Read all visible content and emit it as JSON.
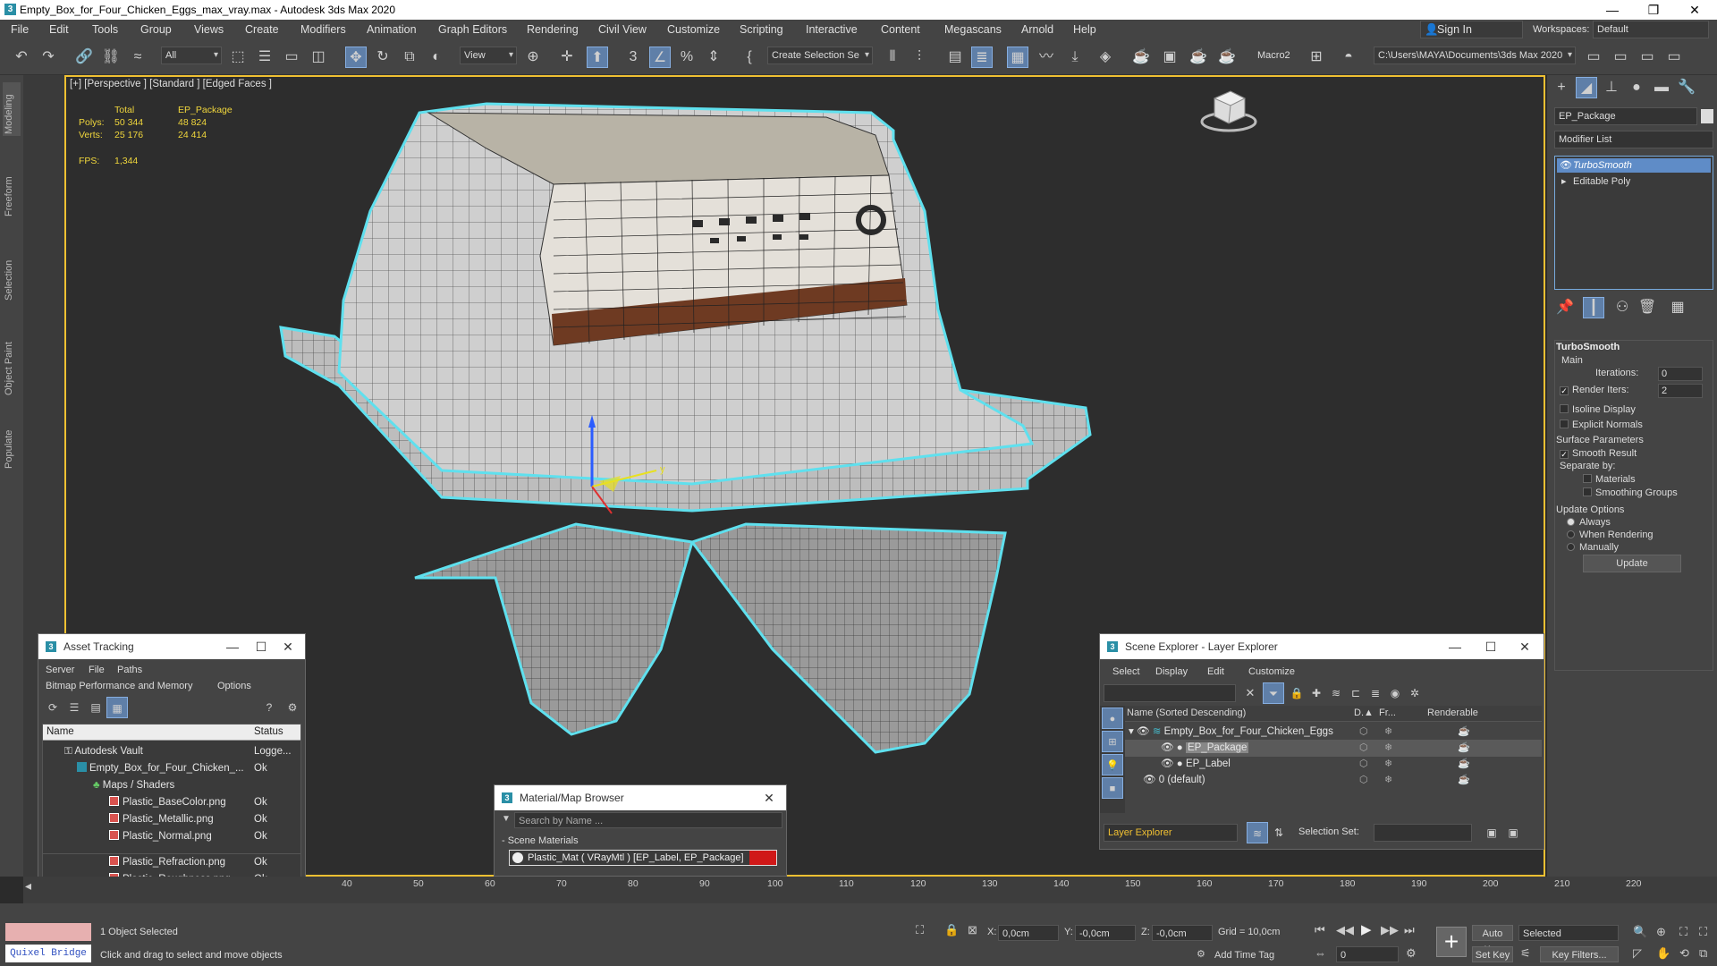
{
  "window": {
    "title": "Empty_Box_for_Four_Chicken_Eggs_max_vray.max - Autodesk 3ds Max 2020",
    "minimize": "—",
    "restore": "❐",
    "close": "✕"
  },
  "menubar": {
    "items": [
      "File",
      "Edit",
      "Tools",
      "Group",
      "Views",
      "Create",
      "Modifiers",
      "Animation",
      "Graph Editors",
      "Rendering",
      "Civil View",
      "Customize",
      "Scripting",
      "Interactive",
      "Content",
      "Megascans",
      "Arnold",
      "Help"
    ],
    "signin": "Sign In",
    "workspaces_label": "Workspaces:",
    "workspace_value": "Default"
  },
  "toolbar": {
    "selection_filter": "All",
    "ref_coord": "View",
    "named_selection": "Create Selection Se",
    "macro": "Macro2",
    "project_path": "C:\\Users\\MAYA\\Documents\\3ds Max 2020"
  },
  "command_tabs": [
    "Modeling",
    "Freeform",
    "Selection",
    "Object Paint",
    "Populate"
  ],
  "viewport": {
    "label": "[+] [Perspective ] [Standard ] [Edged Faces ]",
    "stats": {
      "col_total": "Total",
      "col_object": "EP_Package",
      "polys_label": "Polys:",
      "polys_total": "50 344",
      "polys_obj": "48 824",
      "verts_label": "Verts:",
      "verts_total": "25 176",
      "verts_obj": "24 414",
      "fps_label": "FPS:",
      "fps_value": "1,344"
    },
    "gizmo_axis_y": "y"
  },
  "command_panel": {
    "object_name": "EP_Package",
    "modifier_list": "Modifier List",
    "stack": [
      "TurboSmooth",
      "Editable Poly"
    ],
    "rollout_title": "TurboSmooth",
    "main_label": "Main",
    "iterations_label": "Iterations:",
    "iterations_value": "0",
    "render_iters_label": "Render Iters:",
    "render_iters_value": "2",
    "isoline": "Isoline Display",
    "explicit_normals": "Explicit Normals",
    "surface_params": "Surface Parameters",
    "smooth_result": "Smooth Result",
    "separate_by": "Separate by:",
    "materials": "Materials",
    "smoothing_groups": "Smoothing Groups",
    "update_options": "Update Options",
    "always": "Always",
    "when_rendering": "When Rendering",
    "manually": "Manually",
    "update_button": "Update"
  },
  "asset_tracking": {
    "title": "Asset Tracking",
    "menu1": [
      "Server",
      "File",
      "Paths"
    ],
    "menu2": [
      "Bitmap Performance and Memory",
      "Options"
    ],
    "col_name": "Name",
    "col_status": "Status",
    "rows": [
      {
        "name": "Autodesk Vault",
        "status": "Logge..."
      },
      {
        "name": "Empty_Box_for_Four_Chicken_...",
        "status": "Ok"
      },
      {
        "name": "Maps / Shaders",
        "status": ""
      },
      {
        "name": "Plastic_BaseColor.png",
        "status": "Ok"
      },
      {
        "name": "Plastic_Metallic.png",
        "status": "Ok"
      },
      {
        "name": "Plastic_Normal.png",
        "status": "Ok"
      },
      {
        "name": "Plastic_Refraction.png",
        "status": "Ok"
      },
      {
        "name": "Plastic_Roughness.png",
        "status": "Ok"
      }
    ]
  },
  "material_browser": {
    "title": "Material/Map Browser",
    "search_placeholder": "Search by Name ...",
    "section": "- Scene Materials",
    "material": "Plastic_Mat  ( VRayMtl )  [EP_Label, EP_Package]"
  },
  "scene_explorer": {
    "title": "Scene Explorer - Layer Explorer",
    "menu": [
      "Select",
      "Display",
      "Edit",
      "Customize"
    ],
    "col_name": "Name (Sorted Descending)",
    "col_d": "D.▲",
    "col_fr": "Fr...",
    "col_renderable": "Renderable",
    "rows": [
      "Empty_Box_for_Four_Chicken_Eggs",
      "EP_Package",
      "EP_Label",
      "0 (default)"
    ],
    "explorer_select": "Layer Explorer",
    "selection_set_label": "Selection Set:"
  },
  "timeline": {
    "ticks": [
      "40",
      "50",
      "60",
      "70",
      "80",
      "90",
      "100",
      "110",
      "120",
      "130",
      "140",
      "150",
      "160",
      "170",
      "180",
      "190",
      "200",
      "210",
      "220"
    ]
  },
  "statusbar": {
    "quixel": "Quixel Bridge",
    "selected": "1 Object Selected",
    "prompt": "Click and drag to select and move objects",
    "x_label": "X:",
    "x_value": "0,0cm",
    "y_label": "Y:",
    "y_value": "-0,0cm",
    "z_label": "Z:",
    "z_value": "-0,0cm",
    "grid": "Grid = 10,0cm",
    "add_time_tag": "Add Time Tag",
    "auto_key": "Auto Key",
    "auto_key_value": "Selected",
    "set_key": "Set Key",
    "key_filters": "Key Filters...",
    "frame": "0"
  },
  "colors": {
    "selection_outline": "#5fe0ee",
    "viewport_border": "#f0c032",
    "stats_yellow": "#f0d63c",
    "accent_blue": "#5f8cc7",
    "label_brown": "#6e3a22"
  }
}
